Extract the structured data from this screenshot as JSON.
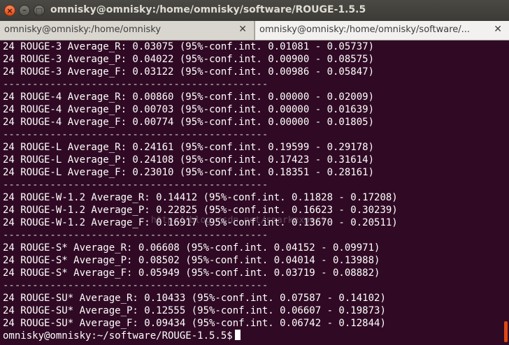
{
  "window": {
    "title": "omnisky@omnisky:/home/omnisky/software/ROUGE-1.5.5",
    "close_glyph": "×",
    "min_glyph": "–",
    "max_glyph": "□"
  },
  "tabs": [
    {
      "label": "omnisky@omnisky:/home/omnisky",
      "close_glyph": "✕"
    },
    {
      "label": "omnisky@omnisky:/home/omnisky/software/...",
      "close_glyph": "✕"
    }
  ],
  "terminal": {
    "lines": [
      "24 ROUGE-3 Average_R: 0.03075 (95%-conf.int. 0.01081 - 0.05737)",
      "24 ROUGE-3 Average_P: 0.04022 (95%-conf.int. 0.00900 - 0.08575)",
      "24 ROUGE-3 Average_F: 0.03122 (95%-conf.int. 0.00986 - 0.05847)",
      "---------------------------------------------",
      "24 ROUGE-4 Average_R: 0.00860 (95%-conf.int. 0.00000 - 0.02009)",
      "24 ROUGE-4 Average_P: 0.00703 (95%-conf.int. 0.00000 - 0.01639)",
      "24 ROUGE-4 Average_F: 0.00774 (95%-conf.int. 0.00000 - 0.01805)",
      "---------------------------------------------",
      "24 ROUGE-L Average_R: 0.24161 (95%-conf.int. 0.19599 - 0.29178)",
      "24 ROUGE-L Average_P: 0.24108 (95%-conf.int. 0.17423 - 0.31614)",
      "24 ROUGE-L Average_F: 0.23010 (95%-conf.int. 0.18351 - 0.28161)",
      "---------------------------------------------",
      "24 ROUGE-W-1.2 Average_R: 0.14412 (95%-conf.int. 0.11828 - 0.17208)",
      "24 ROUGE-W-1.2 Average_P: 0.22825 (95%-conf.int. 0.16623 - 0.30239)",
      "24 ROUGE-W-1.2 Average_F: 0.16917 (95%-conf.int. 0.13670 - 0.20511)",
      "---------------------------------------------",
      "24 ROUGE-S* Average_R: 0.06608 (95%-conf.int. 0.04152 - 0.09971)",
      "24 ROUGE-S* Average_P: 0.08502 (95%-conf.int. 0.04014 - 0.13988)",
      "24 ROUGE-S* Average_F: 0.05949 (95%-conf.int. 0.03719 - 0.08882)",
      "---------------------------------------------",
      "24 ROUGE-SU* Average_R: 0.10433 (95%-conf.int. 0.07587 - 0.14102)",
      "24 ROUGE-SU* Average_P: 0.12555 (95%-conf.int. 0.06607 - 0.19873)",
      "24 ROUGE-SU* Average_F: 0.09434 (95%-conf.int. 0.06742 - 0.12844)"
    ],
    "prompt": "omnisky@omnisky:~/software/ROUGE-1.5.5$"
  },
  "watermark": "http://blog.csdn.net/sparkexpert",
  "colors": {
    "terminal_bg": "#300a24",
    "accent": "#dd4814"
  }
}
